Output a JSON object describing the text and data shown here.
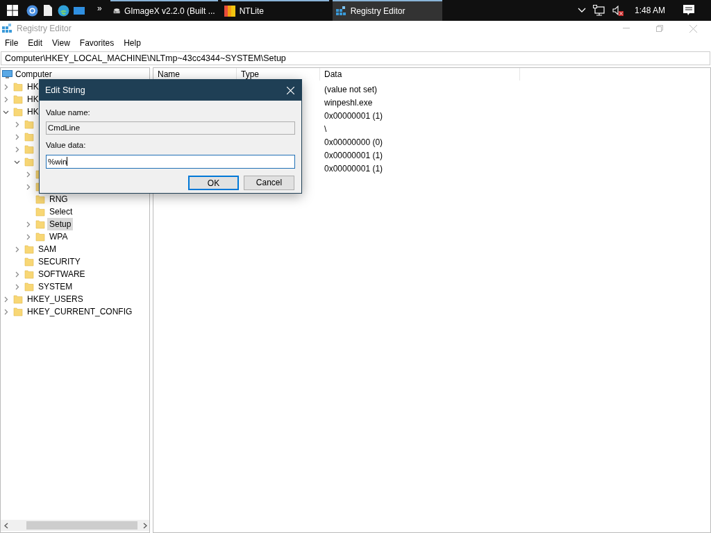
{
  "taskbar": {
    "tasks": [
      {
        "label": "GImageX v2.2.0 (Built ...",
        "kind": "disc",
        "selected": false
      },
      {
        "label": "NTLite",
        "kind": "ntlite",
        "selected": false
      },
      {
        "label": "Registry Editor",
        "kind": "regedit",
        "selected": true
      }
    ],
    "overflow": "»",
    "time": "1:48 AM"
  },
  "window": {
    "title": "Registry Editor",
    "menu": [
      "File",
      "Edit",
      "View",
      "Favorites",
      "Help"
    ],
    "address": "Computer\\HKEY_LOCAL_MACHINE\\NLTmp~43cc4344~SYSTEM\\Setup"
  },
  "tree": {
    "label": "Computer",
    "selected": false,
    "children": [
      {
        "label": "HK",
        "expanded": false,
        "selected": false
      },
      {
        "label": "HK",
        "expanded": false,
        "selected": false
      },
      {
        "label": "HK",
        "expanded": true,
        "selected": false,
        "children": [
          {
            "expanded": false,
            "selected": false
          },
          {
            "expanded": false,
            "selected": false
          },
          {
            "expanded": false,
            "selected": false
          },
          {
            "expanded": true,
            "selected": false,
            "children": [
              {
                "expanded": false,
                "selected": false
              },
              {
                "expanded": false,
                "selected": false
              },
              {
                "label": "RNG",
                "selected": false
              },
              {
                "label": "Select",
                "selected": false
              },
              {
                "label": "Setup",
                "expanded": false,
                "selected": true
              },
              {
                "label": "WPA",
                "expanded": false,
                "selected": false
              }
            ]
          },
          {
            "label": "SAM",
            "expanded": false,
            "selected": false
          },
          {
            "label": "SECURITY",
            "selected": false
          },
          {
            "label": "SOFTWARE",
            "expanded": false,
            "selected": false
          },
          {
            "label": "SYSTEM",
            "expanded": false,
            "selected": false
          }
        ]
      },
      {
        "label": "HKEY_USERS",
        "expanded": false,
        "selected": false
      },
      {
        "label": "HKEY_CURRENT_CONFIG",
        "expanded": false,
        "selected": false
      }
    ]
  },
  "list": {
    "columns": [
      "Name",
      "Type",
      "Data"
    ],
    "data": [
      "(value not set)",
      "winpeshl.exe",
      "0x00000001 (1)",
      "\\",
      "0x00000000 (0)",
      "0x00000001 (1)",
      "0x00000001 (1)"
    ]
  },
  "dialog": {
    "title": "Edit String",
    "value_name_label": "Value name:",
    "value_name": "CmdLine",
    "value_data_label": "Value data:",
    "value_data": "%win",
    "buttons": [
      {
        "label": "OK",
        "default": true
      },
      {
        "label": "Cancel",
        "default": false
      }
    ]
  }
}
